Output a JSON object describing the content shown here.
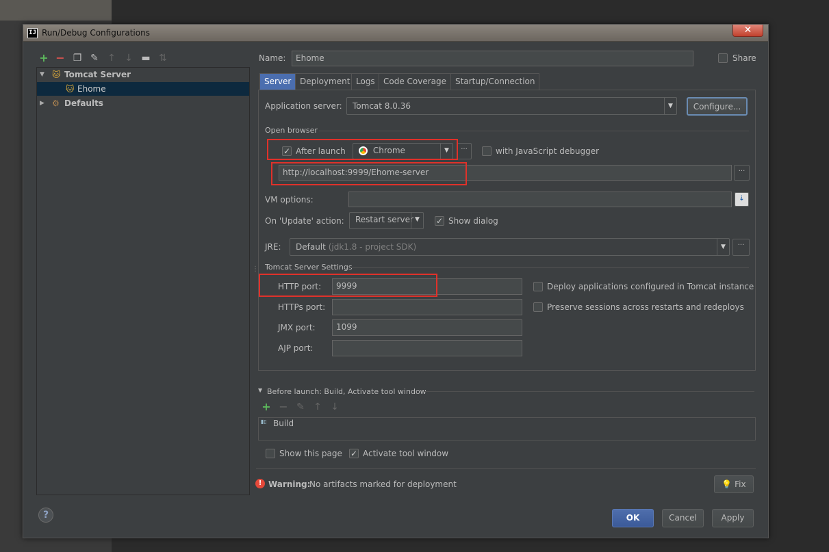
{
  "dialog": {
    "title": "Run/Debug Configurations",
    "title_icon": "IJ"
  },
  "toolbar": {
    "icons": [
      "add-icon",
      "remove-icon",
      "copy-icon",
      "wrench-icon",
      "up-arrow-icon",
      "down-arrow-icon",
      "folder-icon",
      "sort-icon"
    ]
  },
  "tree": {
    "tomcat_server": "Tomcat Server",
    "ehome": "Ehome",
    "defaults": "Defaults"
  },
  "name": {
    "label": "Name:",
    "value": "Ehome"
  },
  "share": {
    "label": "Share",
    "checked": false
  },
  "tabs": [
    {
      "label": "Server",
      "active": true
    },
    {
      "label": "Deployment"
    },
    {
      "label": "Logs"
    },
    {
      "label": "Code Coverage"
    },
    {
      "label": "Startup/Connection"
    }
  ],
  "server": {
    "app_server_label": "Application server:",
    "app_server_value": "Tomcat 8.0.36",
    "configure_label": "Configure...",
    "open_browser_label": "Open browser",
    "after_launch_label": "After launch",
    "browser_value": "Chrome",
    "js_debugger_label": "with JavaScript debugger",
    "url_value": "http://localhost:9999/Ehome-server",
    "vm_options_label": "VM options:",
    "vm_options_value": "",
    "on_update_label": "On 'Update' action:",
    "on_update_value": "Restart server",
    "show_dialog_label": "Show dialog",
    "jre_label": "JRE:",
    "jre_value": "Default",
    "jre_hint": "(jdk1.8 - project SDK)",
    "tomcat_settings_label": "Tomcat Server Settings",
    "http_port_label": "HTTP port:",
    "http_port_value": "9999",
    "https_port_label": "HTTPs port:",
    "https_port_value": "",
    "jmx_port_label": "JMX port:",
    "jmx_port_value": "1099",
    "ajp_port_label": "AJP port:",
    "ajp_port_value": "",
    "deploy_configured_label": "Deploy applications configured in Tomcat instance",
    "preserve_sessions_label": "Preserve sessions across restarts and redeploys"
  },
  "before_launch": {
    "label": "Before launch: Build, Activate tool window",
    "task": "Build",
    "show_page_label": "Show this page",
    "activate_tool_label": "Activate tool window"
  },
  "warning": {
    "label": "Warning:",
    "text": "No artifacts marked for deployment",
    "fix_label": "Fix"
  },
  "buttons": {
    "ok": "OK",
    "cancel": "Cancel",
    "apply": "Apply",
    "help": "?"
  },
  "colors": {
    "dialog_bg": "#3c3f41",
    "selection": "#0d293e",
    "accent": "#4b6eaf",
    "highlight": "#e0312a"
  }
}
